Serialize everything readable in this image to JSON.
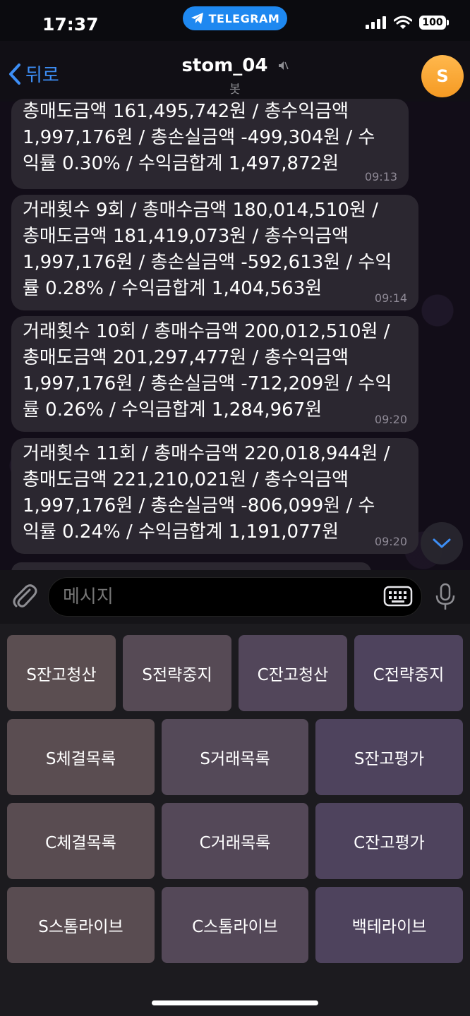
{
  "status_bar": {
    "time": "17:37",
    "banner": "TELEGRAM",
    "battery": "100"
  },
  "header": {
    "back_label": "뒤로",
    "title": "stom_04",
    "subtitle": "봇",
    "avatar_letter": "S"
  },
  "messages": [
    {
      "text": "총매도금액 161,495,742원 / 총수익금액\n1,997,176원 / 총손실금액 -499,304원 / 수\n익률 0.30% / 수익금합계 1,497,872원",
      "time": "09:13"
    },
    {
      "text": "거래횟수 9회 / 총매수금액 180,014,510원 /\n총매도금액 181,419,073원 / 총수익금액\n1,997,176원 / 총손실금액 -592,613원 / 수익\n률 0.28% / 수익금합계 1,404,563원",
      "time": "09:14"
    },
    {
      "text": "거래횟수 10회 / 총매수금액 200,012,510원 /\n총매도금액 201,297,477원 / 총수익금액\n1,997,176원 / 총손실금액 -712,209원 / 수익\n률 0.26% / 수익금합계 1,284,967원",
      "time": "09:20"
    },
    {
      "text": "거래횟수 11회 / 총매수금액 220,018,944원 /\n총매도금액 221,210,021원 / 총수익금액\n1,997,176원 / 총손실금액 -806,099원 / 수\n익률 0.24% / 수익금합계 1,191,077원",
      "time": "09:20"
    }
  ],
  "input": {
    "placeholder": "메시지"
  },
  "keyboard": {
    "row1": [
      "S잔고청산",
      "S전략중지",
      "C잔고청산",
      "C전략중지"
    ],
    "row2": [
      "S체결목록",
      "S거래목록",
      "S잔고평가"
    ],
    "row3": [
      "C체결목록",
      "C거래목록",
      "C잔고평가"
    ],
    "row4": [
      "S스톰라이브",
      "C스톰라이브",
      "백테라이브"
    ]
  },
  "colors": {
    "accent": "#3d8ef5",
    "bubble": "#2b2730",
    "avatar": "#f59a23",
    "telegram_pill": "#1e88f0"
  }
}
